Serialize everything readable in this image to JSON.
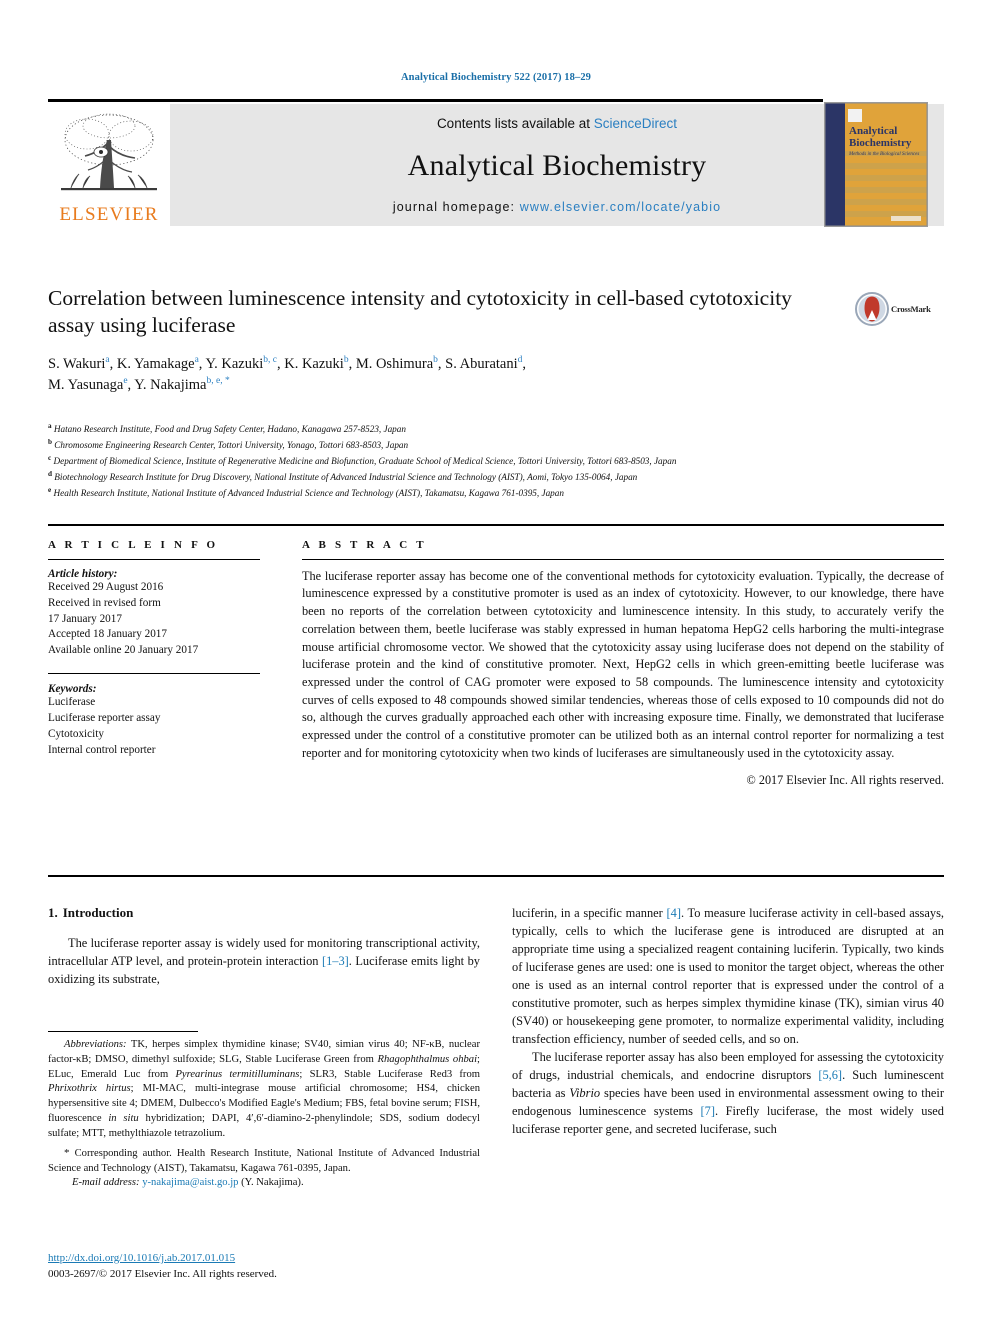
{
  "running_head": "Analytical Biochemistry 522 (2017) 18–29",
  "banner": {
    "contents_prefix": "Contents lists available at ",
    "contents_link": "ScienceDirect",
    "journal_name": "Analytical Biochemistry",
    "homepage_prefix": "journal homepage: ",
    "homepage_url": "www.elsevier.com/locate/yabio",
    "publisher_wordmark": "ELSEVIER",
    "cover_title_line1": "Analytical",
    "cover_title_line2": "Biochemistry",
    "cover_subtitle": "Methods in the Biological Sciences"
  },
  "crossmark": {
    "label": "CrossMark"
  },
  "title": "Correlation between luminescence intensity and cytotoxicity in cell-based cytotoxicity assay using luciferase",
  "authors": [
    {
      "name": "S. Wakuri",
      "marks": "a",
      "sep": ", "
    },
    {
      "name": "K. Yamakage",
      "marks": "a",
      "sep": ", "
    },
    {
      "name": "Y. Kazuki",
      "marks": "b, c",
      "sep": ", "
    },
    {
      "name": "K. Kazuki",
      "marks": "b",
      "sep": ", "
    },
    {
      "name": "M. Oshimura",
      "marks": "b",
      "sep": ", "
    },
    {
      "name": "S. Aburatani",
      "marks": "d",
      "sep": ", "
    },
    {
      "name": "M. Yasunaga",
      "marks": "e",
      "sep": ", "
    },
    {
      "name": "Y. Nakajima",
      "marks": "b, e, *",
      "sep": ""
    }
  ],
  "affiliations": [
    {
      "mark": "a",
      "text": "Hatano Research Institute, Food and Drug Safety Center, Hadano, Kanagawa 257-8523, Japan"
    },
    {
      "mark": "b",
      "text": "Chromosome Engineering Research Center, Tottori University, Yonago, Tottori 683-8503, Japan"
    },
    {
      "mark": "c",
      "text": "Department of Biomedical Science, Institute of Regenerative Medicine and Biofunction, Graduate School of Medical Science, Tottori University, Tottori 683-8503, Japan"
    },
    {
      "mark": "d",
      "text": "Biotechnology Research Institute for Drug Discovery, National Institute of Advanced Industrial Science and Technology (AIST), Aomi, Tokyo 135-0064, Japan"
    },
    {
      "mark": "e",
      "text": "Health Research Institute, National Institute of Advanced Industrial Science and Technology (AIST), Takamatsu, Kagawa 761-0395, Japan"
    }
  ],
  "article_info": {
    "heading": "A R T I C L E   I N F O",
    "history_label": "Article history:",
    "history": [
      "Received 29 August 2016",
      "Received in revised form",
      "17 January 2017",
      "Accepted 18 January 2017",
      "Available online 20 January 2017"
    ],
    "keywords_label": "Keywords:",
    "keywords": [
      "Luciferase",
      "Luciferase reporter assay",
      "Cytotoxicity",
      "Internal control reporter"
    ]
  },
  "abstract": {
    "heading": "A B S T R A C T",
    "text": "The luciferase reporter assay has become one of the conventional methods for cytotoxicity evaluation. Typically, the decrease of luminescence expressed by a constitutive promoter is used as an index of cytotoxicity. However, to our knowledge, there have been no reports of the correlation between cytotoxicity and luminescence intensity. In this study, to accurately verify the correlation between them, beetle luciferase was stably expressed in human hepatoma HepG2 cells harboring the multi-integrase mouse artificial chromosome vector. We showed that the cytotoxicity assay using luciferase does not depend on the stability of luciferase protein and the kind of constitutive promoter. Next, HepG2 cells in which green-emitting beetle luciferase was expressed under the control of CAG promoter were exposed to 58 compounds. The luminescence intensity and cytotoxicity curves of cells exposed to 48 compounds showed similar tendencies, whereas those of cells exposed to 10 compounds did not do so, although the curves gradually approached each other with increasing exposure time. Finally, we demonstrated that luciferase expressed under the control of a constitutive promoter can be utilized both as an internal control reporter for normalizing a test reporter and for monitoring cytotoxicity when two kinds of luciferases are simultaneously used in the cytotoxicity assay.",
    "copyright": "© 2017 Elsevier Inc. All rights reserved."
  },
  "intro": {
    "number": "1.",
    "heading": "Introduction",
    "p1_a": "The luciferase reporter assay is widely used for monitoring transcriptional activity, intracellular ATP level, and protein-protein interaction ",
    "p1_ref": "[1–3]",
    "p1_b": ". Luciferase emits light by oxidizing its substrate, luciferin, in a specific manner ",
    "p1_ref2": "[4]",
    "p1_c": ". To measure luciferase activity in cell-based assays, typically, cells to which the luciferase gene is introduced are disrupted at an appropriate time using a specialized reagent containing luciferin. Typically, two kinds of luciferase genes are used: one is used to monitor the target object, whereas the other one is used as an internal control reporter that is expressed under the control of a constitutive promoter, such as herpes simplex thymidine kinase (TK), simian virus 40 (SV40) or housekeeping gene promoter, to normalize experimental validity, including transfection efficiency, number of seeded cells, and so on.",
    "p2_a": "The luciferase reporter assay has also been employed for assessing the cytotoxicity of drugs, industrial chemicals, and endocrine disruptors ",
    "p2_ref": "[5,6]",
    "p2_b": ". Such luminescent bacteria as ",
    "p2_ital": "Vibrio",
    "p2_c": " species have been used in environmental assessment owing to their endogenous luminescence systems ",
    "p2_ref2": "[7]",
    "p2_d": ". Firefly luciferase, the most widely used luciferase reporter gene, and secreted luciferase, such"
  },
  "footnotes": {
    "abbrev_label": "Abbreviations:",
    "abbrev_1": " TK, herpes simplex thymidine kinase; SV40, simian virus 40; NF-κB, nuclear factor-κB; DMSO, dimethyl sulfoxide; SLG, Stable Luciferase Green from ",
    "abbrev_ital_1": "Rhagophthalmus ohbai",
    "abbrev_2": "; ELuc, Emerald Luc from ",
    "abbrev_ital_2": "Pyrearinus termitilluminans",
    "abbrev_3": "; SLR3, Stable Luciferase Red3 from ",
    "abbrev_ital_3": "Phrixothrix hirtus",
    "abbrev_4": "; MI-MAC, multi-integrase mouse artificial chromosome; HS4, chicken hypersensitive site 4; DMEM, Dulbecco's Modified Eagle's Medium; FBS, fetal bovine serum; FISH, fluorescence ",
    "abbrev_ital_4": "in situ",
    "abbrev_5": " hybridization; DAPI, 4′,6′-diamino-2-phenylindole; SDS, sodium dodecyl sulfate; MTT, methylthiazole tetrazolium.",
    "corresponding_star": "*",
    "corresponding": " Corresponding author. Health Research Institute, National Institute of Advanced Industrial Science and Technology (AIST), Takamatsu, Kagawa 761-0395, Japan.",
    "email_label": "E-mail address:",
    "email": "y-nakajima@aist.go.jp",
    "email_suffix": " (Y. Nakajima).",
    "doi": "http://dx.doi.org/10.1016/j.ab.2017.01.015",
    "issn": "0003-2697/© 2017 Elsevier Inc. All rights reserved."
  },
  "colors": {
    "link_blue": "#1a7ab5",
    "elsevier_orange": "#e87b1e",
    "banner_grey": "#e6e6e6",
    "cover_navy": "#2b3566",
    "cover_amber": "#e0a33a"
  }
}
